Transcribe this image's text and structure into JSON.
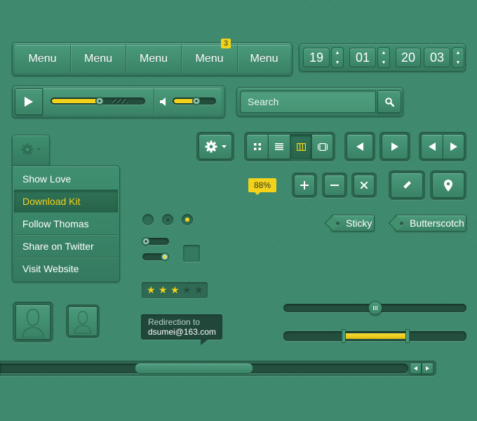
{
  "menu_bar": {
    "items": [
      "Menu",
      "Menu",
      "Menu",
      "Menu",
      "Menu"
    ],
    "badge_count": "3"
  },
  "time_picker": {
    "segments": [
      "19",
      "01",
      "20",
      "03"
    ],
    "up_symbol": "▲",
    "down_symbol": "▼"
  },
  "media_player": {
    "progress": 0.52,
    "volume": 0.55,
    "icons": [
      "play-icon",
      "speaker-icon"
    ]
  },
  "search": {
    "placeholder": "Search",
    "icon": "search-icon"
  },
  "settings_dropdown": {
    "icon": "gear-icon",
    "items": [
      "Show Love",
      "Download Kit",
      "Follow Thomas",
      "Share on Twitter",
      "Visit Website"
    ],
    "active_index": 1
  },
  "view_toggle": {
    "icons": [
      "grid-view-icon",
      "list-view-icon",
      "columns-view-icon",
      "gallery-view-icon"
    ],
    "active_index": 2
  },
  "percent_tooltip": "88%",
  "action_buttons": {
    "icons": [
      "plus-icon",
      "minus-icon",
      "close-icon",
      "pencil-icon",
      "map-pin-icon"
    ]
  },
  "tags": [
    "Sticky",
    "Butterscotch"
  ],
  "rating": {
    "value": 3,
    "max": 5
  },
  "redirect_tooltip": {
    "line1": "Redirection to",
    "line2": "dsumei@163.com"
  },
  "slider_single": {
    "value": 0.5
  },
  "slider_range": {
    "min": 0.33,
    "max": 0.68
  },
  "scrollbar": {
    "thumb_start": 0.33,
    "thumb_end": 0.62
  },
  "colors": {
    "background": "#3e8a6e",
    "accent": "#f3d21a",
    "dark": "#244f3f"
  }
}
